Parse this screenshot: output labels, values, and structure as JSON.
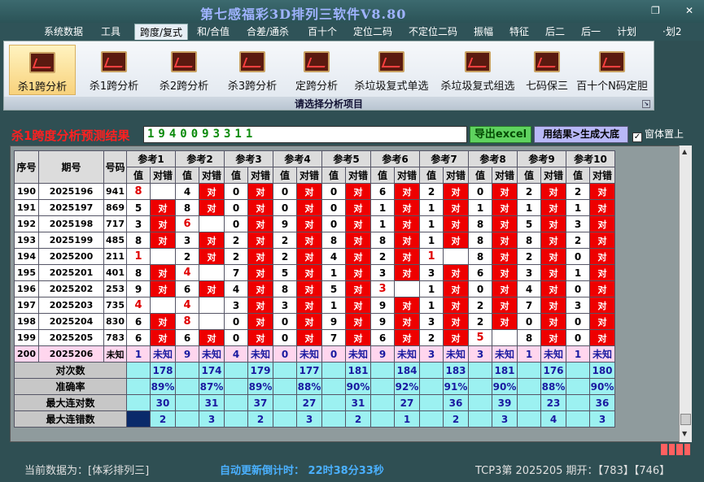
{
  "window": {
    "title": "第七感福彩3D排列三软件V8.80",
    "restore": "❐",
    "close": "✕"
  },
  "menu": [
    "系统数据",
    "工具",
    "跨度/复式",
    "和/合值",
    "合差/通杀",
    "百十个",
    "定位二码",
    "不定位二码",
    "振幅",
    "特征",
    "后二",
    "后一",
    "计划",
    "·划2"
  ],
  "menu_active_index": 2,
  "ribbon": {
    "buttons": [
      "杀1跨分析",
      "杀1跨分析",
      "杀2跨分析",
      "杀3跨分析",
      "定跨分析",
      "杀垃圾复式单选",
      "杀垃圾复式组选",
      "七码保三",
      "百十个N码定胆"
    ],
    "selected_index": 0,
    "group_label": "请选择分析项目",
    "launcher": "↘"
  },
  "result": {
    "title": "杀1跨度分析预测结果",
    "value": "1940093311"
  },
  "buttons": {
    "export": "导出excel",
    "generate": "用结果>生成大底"
  },
  "topmost": {
    "label": "窗体置上",
    "checked": true,
    "check_glyph": "✓"
  },
  "grid": {
    "headers": {
      "seq": "序号",
      "issue": "期号",
      "code": "号码",
      "value": "值",
      "check": "对错"
    },
    "refs": [
      "参考1",
      "参考2",
      "参考3",
      "参考4",
      "参考5",
      "参考6",
      "参考7",
      "参考8",
      "参考9",
      "参考10"
    ],
    "rows": [
      {
        "seq": "190",
        "issue": "2025196",
        "code": "941",
        "cells": [
          [
            "8",
            "",
            "r"
          ],
          [
            "4",
            "对",
            ""
          ],
          [
            "0",
            "对",
            ""
          ],
          [
            "0",
            "对",
            ""
          ],
          [
            "0",
            "对",
            ""
          ],
          [
            "6",
            "对",
            ""
          ],
          [
            "2",
            "对",
            ""
          ],
          [
            "0",
            "对",
            ""
          ],
          [
            "2",
            "对",
            ""
          ],
          [
            "2",
            "对",
            ""
          ]
        ]
      },
      {
        "seq": "191",
        "issue": "2025197",
        "code": "869",
        "cells": [
          [
            "5",
            "对",
            ""
          ],
          [
            "8",
            "对",
            ""
          ],
          [
            "0",
            "对",
            ""
          ],
          [
            "0",
            "对",
            ""
          ],
          [
            "0",
            "对",
            ""
          ],
          [
            "1",
            "对",
            ""
          ],
          [
            "1",
            "对",
            ""
          ],
          [
            "1",
            "对",
            ""
          ],
          [
            "1",
            "对",
            ""
          ],
          [
            "1",
            "对",
            ""
          ]
        ]
      },
      {
        "seq": "192",
        "issue": "2025198",
        "code": "717",
        "cells": [
          [
            "3",
            "对",
            ""
          ],
          [
            "6",
            "",
            "r"
          ],
          [
            "0",
            "对",
            ""
          ],
          [
            "9",
            "对",
            ""
          ],
          [
            "0",
            "对",
            ""
          ],
          [
            "1",
            "对",
            ""
          ],
          [
            "1",
            "对",
            ""
          ],
          [
            "8",
            "对",
            ""
          ],
          [
            "5",
            "对",
            ""
          ],
          [
            "3",
            "对",
            ""
          ]
        ]
      },
      {
        "seq": "193",
        "issue": "2025199",
        "code": "485",
        "cells": [
          [
            "8",
            "对",
            ""
          ],
          [
            "3",
            "对",
            ""
          ],
          [
            "2",
            "对",
            ""
          ],
          [
            "2",
            "对",
            ""
          ],
          [
            "8",
            "对",
            ""
          ],
          [
            "8",
            "对",
            ""
          ],
          [
            "1",
            "对",
            ""
          ],
          [
            "8",
            "对",
            ""
          ],
          [
            "8",
            "对",
            ""
          ],
          [
            "2",
            "对",
            ""
          ]
        ]
      },
      {
        "seq": "194",
        "issue": "2025200",
        "code": "211",
        "cells": [
          [
            "1",
            "",
            "r"
          ],
          [
            "2",
            "对",
            ""
          ],
          [
            "2",
            "对",
            ""
          ],
          [
            "2",
            "对",
            ""
          ],
          [
            "4",
            "对",
            ""
          ],
          [
            "2",
            "对",
            ""
          ],
          [
            "1",
            "",
            "r"
          ],
          [
            "8",
            "对",
            ""
          ],
          [
            "2",
            "对",
            ""
          ],
          [
            "0",
            "对",
            ""
          ]
        ]
      },
      {
        "seq": "195",
        "issue": "2025201",
        "code": "401",
        "cells": [
          [
            "8",
            "对",
            ""
          ],
          [
            "4",
            "",
            "r"
          ],
          [
            "7",
            "对",
            ""
          ],
          [
            "5",
            "对",
            ""
          ],
          [
            "1",
            "对",
            ""
          ],
          [
            "3",
            "对",
            ""
          ],
          [
            "3",
            "对",
            ""
          ],
          [
            "6",
            "对",
            ""
          ],
          [
            "3",
            "对",
            ""
          ],
          [
            "1",
            "对",
            ""
          ]
        ]
      },
      {
        "seq": "196",
        "issue": "2025202",
        "code": "253",
        "cells": [
          [
            "9",
            "对",
            ""
          ],
          [
            "6",
            "对",
            ""
          ],
          [
            "4",
            "对",
            ""
          ],
          [
            "8",
            "对",
            ""
          ],
          [
            "5",
            "对",
            ""
          ],
          [
            "3",
            "",
            "r"
          ],
          [
            "1",
            "对",
            ""
          ],
          [
            "0",
            "对",
            ""
          ],
          [
            "4",
            "对",
            ""
          ],
          [
            "0",
            "对",
            ""
          ]
        ]
      },
      {
        "seq": "197",
        "issue": "2025203",
        "code": "735",
        "cells": [
          [
            "4",
            "",
            "r"
          ],
          [
            "4",
            "",
            "r"
          ],
          [
            "3",
            "对",
            ""
          ],
          [
            "3",
            "对",
            ""
          ],
          [
            "1",
            "对",
            ""
          ],
          [
            "9",
            "对",
            ""
          ],
          [
            "1",
            "对",
            ""
          ],
          [
            "2",
            "对",
            ""
          ],
          [
            "7",
            "对",
            ""
          ],
          [
            "3",
            "对",
            ""
          ]
        ]
      },
      {
        "seq": "198",
        "issue": "2025204",
        "code": "830",
        "cells": [
          [
            "6",
            "对",
            ""
          ],
          [
            "8",
            "",
            "r"
          ],
          [
            "0",
            "对",
            ""
          ],
          [
            "0",
            "对",
            ""
          ],
          [
            "9",
            "对",
            ""
          ],
          [
            "9",
            "对",
            ""
          ],
          [
            "3",
            "对",
            ""
          ],
          [
            "2",
            "对",
            ""
          ],
          [
            "0",
            "对",
            ""
          ],
          [
            "0",
            "对",
            ""
          ]
        ]
      },
      {
        "seq": "199",
        "issue": "2025205",
        "code": "783",
        "cells": [
          [
            "6",
            "对",
            ""
          ],
          [
            "6",
            "对",
            ""
          ],
          [
            "0",
            "对",
            ""
          ],
          [
            "0",
            "对",
            ""
          ],
          [
            "7",
            "对",
            ""
          ],
          [
            "6",
            "对",
            ""
          ],
          [
            "2",
            "对",
            ""
          ],
          [
            "5",
            "",
            "r"
          ],
          [
            "8",
            "对",
            ""
          ],
          [
            "0",
            "对",
            ""
          ]
        ]
      }
    ],
    "pending": {
      "seq": "200",
      "issue": "2025206",
      "code": "未知",
      "values": [
        "1",
        "9",
        "4",
        "0",
        "0",
        "9",
        "3",
        "3",
        "1",
        "1"
      ],
      "check": "未知"
    },
    "stats": [
      {
        "label": "对次数",
        "values": [
          "178",
          "174",
          "179",
          "177",
          "181",
          "184",
          "183",
          "181",
          "176",
          "180"
        ]
      },
      {
        "label": "准确率",
        "values": [
          "89%",
          "87%",
          "89%",
          "88%",
          "90%",
          "92%",
          "91%",
          "90%",
          "88%",
          "90%"
        ]
      },
      {
        "label": "最大连对数",
        "values": [
          "30",
          "31",
          "37",
          "27",
          "31",
          "27",
          "36",
          "39",
          "23",
          "36"
        ]
      },
      {
        "label": "最大连错数",
        "values": [
          "2",
          "3",
          "2",
          "3",
          "2",
          "1",
          "2",
          "3",
          "4",
          "3"
        ]
      }
    ]
  },
  "footer": {
    "current_data": "当前数据为：[体彩排列三]",
    "countdown": "自动更新倒计时：  22时38分33秒",
    "tcp": "TCP3第 2025205 期开：【783】【746】"
  },
  "colors": {
    "hit": "#ee0000",
    "stat": "#9cf1f1",
    "pending": "#ffd6ee",
    "title": "#9fb3ff"
  }
}
